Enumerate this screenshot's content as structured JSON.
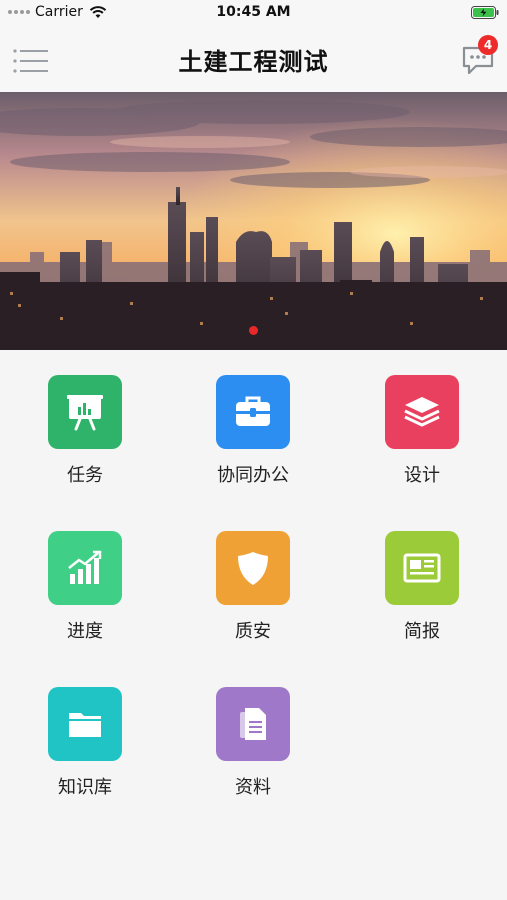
{
  "status_bar": {
    "carrier": "Carrier",
    "time": "10:45 AM",
    "wifi_icon": "wifi-icon",
    "battery_icon": "battery-charging-icon"
  },
  "nav": {
    "title": "土建工程测试",
    "menu_icon": "hamburger-menu-icon",
    "message_icon": "chat-bubble-icon",
    "message_count": "4"
  },
  "banner": {
    "image": "city-skyline-at-sunset",
    "active_slide_indicator_color": "#e8282b"
  },
  "modules": [
    {
      "label": "任务",
      "icon": "presentation-board-icon",
      "color": "#2fb36a"
    },
    {
      "label": "协同办公",
      "icon": "briefcase-icon",
      "color": "#2b8ef0"
    },
    {
      "label": "设计",
      "icon": "layers-icon",
      "color": "#e8405e"
    },
    {
      "label": "进度",
      "icon": "growth-chart-icon",
      "color": "#3fcf86"
    },
    {
      "label": "质安",
      "icon": "shield-icon",
      "color": "#f0a136"
    },
    {
      "label": "简报",
      "icon": "newspaper-icon",
      "color": "#9ccb3a"
    },
    {
      "label": "知识库",
      "icon": "folder-icon",
      "color": "#21c4c4"
    },
    {
      "label": "资料",
      "icon": "documents-icon",
      "color": "#9f78c9"
    }
  ]
}
